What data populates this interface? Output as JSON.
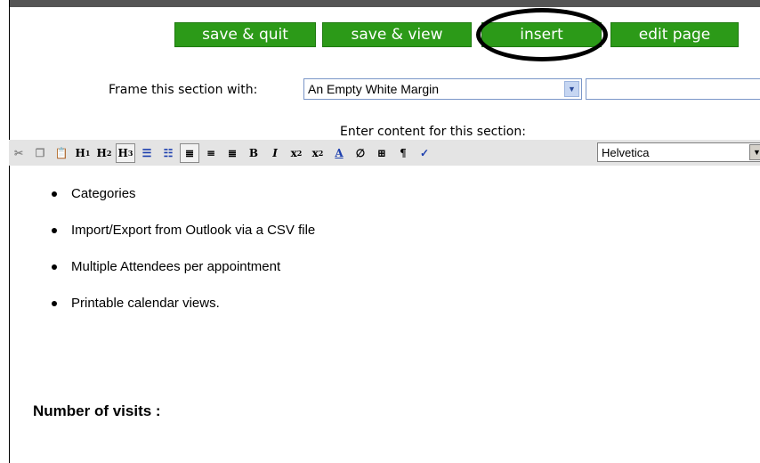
{
  "header": {
    "buttons": {
      "save_quit": "save & quit",
      "save_view": "save & view",
      "insert": "insert",
      "edit_page": "edit page"
    },
    "button_color": "#2c9a18"
  },
  "frame": {
    "label": "Frame this section with:",
    "selected": "An Empty White Margin"
  },
  "content_prompt": "Enter content for this section:",
  "toolbar": {
    "icons": [
      "cut-icon",
      "copy-icon",
      "paste-icon",
      "heading1-icon",
      "heading2-icon",
      "heading3-icon",
      "bulleted-list-icon",
      "numbered-list-icon",
      "align-left-icon",
      "align-center-icon",
      "align-right-icon",
      "bold-icon",
      "italic-icon",
      "subscript-icon",
      "superscript-icon",
      "font-color-icon",
      "link-icon",
      "table-icon",
      "paragraph-icon",
      "spellcheck-icon"
    ],
    "font_selected": "Helvetica"
  },
  "content": {
    "items": [
      "Categories",
      "Import/Export from Outlook via a CSV file",
      "Multiple Attendees per appointment",
      "Printable calendar views."
    ],
    "visits_label": "Number of visits :"
  }
}
